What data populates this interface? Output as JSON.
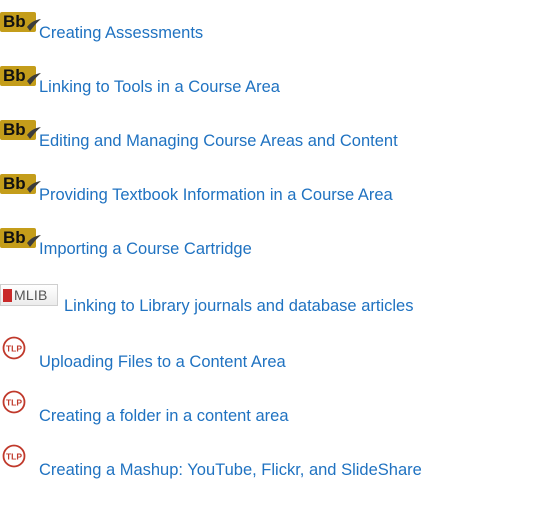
{
  "icons": {
    "blackboard": {
      "text": "Bb",
      "color": "#c49d1a"
    },
    "mlib": {
      "text": "MLIB",
      "color": "#c92a2a"
    },
    "tlp": {
      "text": "TLP",
      "color": "#c0392b"
    }
  },
  "link_color": "#1f72c1",
  "links": [
    {
      "icon": "blackboard-logo-icon",
      "label": "Creating Assessments"
    },
    {
      "icon": "blackboard-logo-icon",
      "label": "Linking to Tools in a Course Area"
    },
    {
      "icon": "blackboard-logo-icon",
      "label": "Editing and Managing Course Areas and Content"
    },
    {
      "icon": "blackboard-logo-icon",
      "label": "Providing Textbook Information in a Course Area"
    },
    {
      "icon": "blackboard-logo-icon",
      "label": "Importing a Course Cartridge"
    },
    {
      "icon": "mlib-logo-icon",
      "label": "Linking to Library journals and database articles"
    },
    {
      "icon": "tlp-logo-icon",
      "label": "Uploading Files to a Content Area"
    },
    {
      "icon": "tlp-logo-icon",
      "label": "Creating a folder in a content area"
    },
    {
      "icon": "tlp-logo-icon",
      "label": "Creating a Mashup: YouTube, Flickr, and SlideShare"
    }
  ]
}
